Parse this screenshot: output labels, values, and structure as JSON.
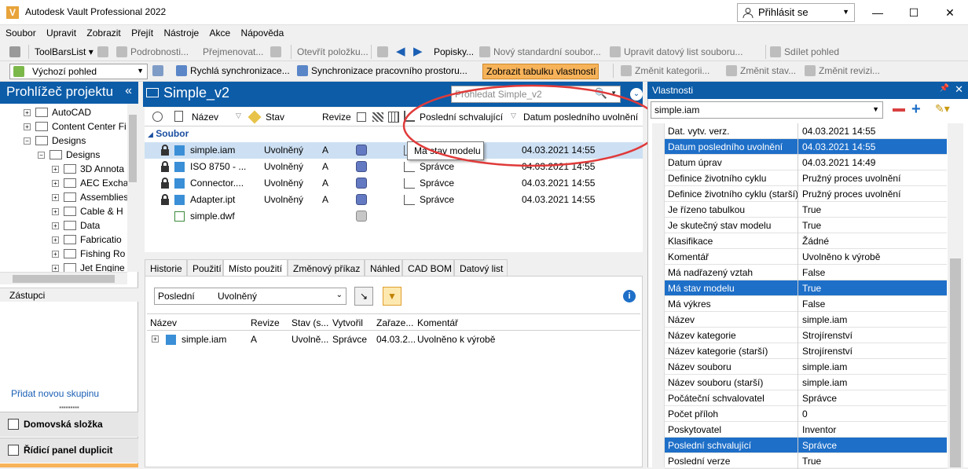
{
  "window": {
    "title": "Autodesk Vault Professional 2022",
    "signin": "Přihlásit se"
  },
  "menu": [
    "Soubor",
    "Upravit",
    "Zobrazit",
    "Přejít",
    "Nástroje",
    "Akce",
    "Nápověda"
  ],
  "toolbar1": {
    "toolbarslist": "ToolBarsList",
    "podrobnosti": "Podrobnosti...",
    "prejmenovat": "Přejmenovat...",
    "otevrit": "Otevřít položku...",
    "popisky": "Popisky...",
    "novy": "Nový standardní soubor...",
    "upravit_list": "Upravit datový list souboru...",
    "sdilet": "Sdílet pohled"
  },
  "toolbar2": {
    "pohled": "Výchozí pohled",
    "rychla_sync": "Rychlá synchronizace...",
    "sync_prostoru": "Synchronizace pracovního prostoru...",
    "zobrazit_tab": "Zobrazit tabulku vlastností",
    "zmenit_kat": "Změnit kategorii...",
    "zmenit_stav": "Změnit stav...",
    "zmenit_rev": "Změnit revizi..."
  },
  "project_browser": {
    "title": "Prohlížeč projektu",
    "tree": [
      {
        "label": "AutoCAD",
        "level": 1
      },
      {
        "label": "Content Center Fi",
        "level": 1
      },
      {
        "label": "Designs",
        "level": 1
      },
      {
        "label": "Designs",
        "level": 2
      },
      {
        "label": "3D Annota",
        "level": 3
      },
      {
        "label": "AEC Excha",
        "level": 3
      },
      {
        "label": "Assemblies",
        "level": 3
      },
      {
        "label": "Cable & H",
        "level": 3
      },
      {
        "label": "Data",
        "level": 3
      },
      {
        "label": "Fabricatio",
        "level": 3
      },
      {
        "label": "Fishing Ro",
        "level": 3
      },
      {
        "label": "Jet Engine",
        "level": 3
      }
    ],
    "shortcuts_title": "Zástupci",
    "add_group": "Přidat novou skupinu",
    "nav_home": "Domovská složka",
    "nav_dup": "Řídicí panel duplicit"
  },
  "main": {
    "folder": "Simple_v2",
    "search_placeholder": "Prohledat Simple_v2",
    "columns": {
      "name": "Název",
      "state": "Stav",
      "rev": "Revize",
      "approver": "Poslední schvalující",
      "date": "Datum posledního uvolnění"
    },
    "group": "Soubor",
    "tooltip": "Má stav modelu",
    "rows": [
      {
        "name": "simple.iam",
        "state": "Uvolněný",
        "rev": "A",
        "approver": "",
        "date": "04.03.2021 14:55"
      },
      {
        "name": "ISO 8750 - ...",
        "state": "Uvolněný",
        "rev": "A",
        "approver": "Správce",
        "date": "04.03.2021 14:55"
      },
      {
        "name": "Connector....",
        "state": "Uvolněný",
        "rev": "A",
        "approver": "Správce",
        "date": "04.03.2021 14:55"
      },
      {
        "name": "Adapter.ipt",
        "state": "Uvolněný",
        "rev": "A",
        "approver": "Správce",
        "date": "04.03.2021 14:55"
      },
      {
        "name": "simple.dwf",
        "state": "",
        "rev": "",
        "approver": "",
        "date": ""
      }
    ]
  },
  "lower_tabs": [
    "Historie",
    "Použití",
    "Místo použití",
    "Změnový příkaz",
    "Náhled",
    "CAD BOM",
    "Datový list"
  ],
  "where_used": {
    "filter1": "Poslední",
    "filter2": "Uvolněný",
    "columns": [
      "Název",
      "Revize",
      "Stav (s...",
      "Vytvořil",
      "Zařaze...",
      "Komentář"
    ],
    "row": [
      "simple.iam",
      "A",
      "Uvolně...",
      "Správce",
      "04.03.2...",
      "Uvolněno k výrobě"
    ]
  },
  "properties": {
    "title": "Vlastnosti",
    "selected": "simple.iam",
    "rows": [
      {
        "k": "Dat. vytv. verz.",
        "v": "04.03.2021 14:55"
      },
      {
        "k": "Datum posledního uvolnění",
        "v": "04.03.2021 14:55"
      },
      {
        "k": "Datum úprav",
        "v": "04.03.2021 14:49"
      },
      {
        "k": "Definice životního cyklu",
        "v": "Pružný proces uvolnění"
      },
      {
        "k": "Definice životního cyklu (starší)",
        "v": "Pružný proces uvolnění"
      },
      {
        "k": "Je řízeno tabulkou",
        "v": "True"
      },
      {
        "k": "Je skutečný stav modelu",
        "v": "True"
      },
      {
        "k": "Klasifikace",
        "v": "Žádné"
      },
      {
        "k": "Komentář",
        "v": "Uvolněno k výrobě"
      },
      {
        "k": "Má nadřazený vztah",
        "v": "False"
      },
      {
        "k": "Má stav modelu",
        "v": "True"
      },
      {
        "k": "Má výkres",
        "v": "False"
      },
      {
        "k": "Název",
        "v": "simple.iam"
      },
      {
        "k": "Název kategorie",
        "v": "Strojírenství"
      },
      {
        "k": "Název kategorie (starší)",
        "v": "Strojírenství"
      },
      {
        "k": "Název souboru",
        "v": "simple.iam"
      },
      {
        "k": "Název souboru (starší)",
        "v": "simple.iam"
      },
      {
        "k": "Počáteční schvalovatel",
        "v": "Správce"
      },
      {
        "k": "Počet příloh",
        "v": "0"
      },
      {
        "k": "Poskytovatel",
        "v": "Inventor"
      },
      {
        "k": "Poslední schvalující",
        "v": "Správce"
      },
      {
        "k": "Poslední verze",
        "v": "True"
      }
    ]
  },
  "colors": {
    "accent": "#0c5ca8",
    "selection": "#1e6fc8",
    "highlight_button": "#f7b35a",
    "circle": "#e03a3a"
  }
}
